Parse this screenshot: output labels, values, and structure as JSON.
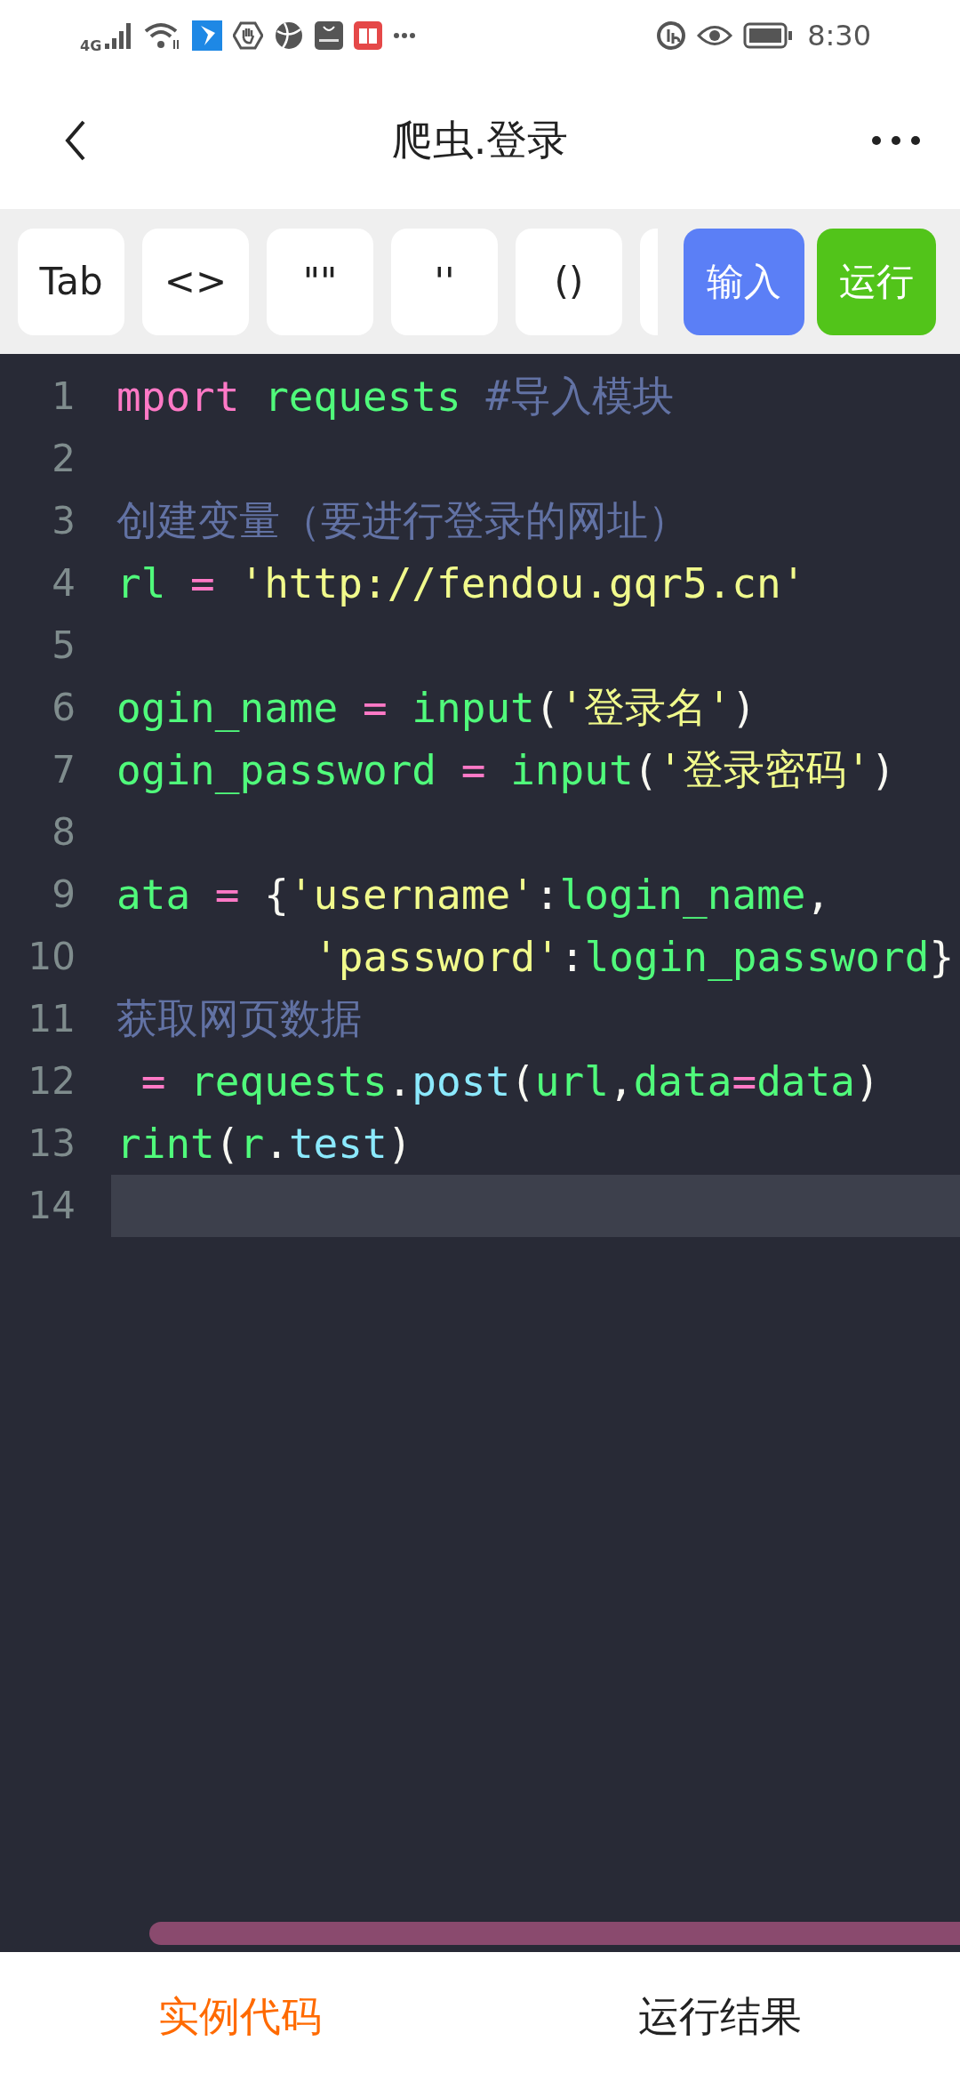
{
  "status_bar": {
    "network": "4G",
    "time": "8:30"
  },
  "header": {
    "title": "爬虫.登录"
  },
  "toolbar": {
    "keys": [
      "Tab",
      "<>",
      "\"\"",
      "''",
      "()"
    ],
    "input_button": "输入",
    "run_button": "运行"
  },
  "editor": {
    "lines": [
      {
        "number": "1",
        "current": false,
        "tokens": [
          {
            "kind": "keyword",
            "text": "mport"
          },
          {
            "kind": "name",
            "text": " requests"
          },
          {
            "kind": "comment",
            "text": " #导入模块"
          }
        ]
      },
      {
        "number": "2",
        "current": false
      },
      {
        "number": "3",
        "current": false,
        "tokens": [
          {
            "kind": "comment",
            "text": "创建变量（要进行登录的网址）"
          }
        ]
      },
      {
        "number": "4",
        "current": false,
        "tokens": [
          {
            "kind": "name",
            "text": "rl"
          },
          {
            "kind": "op",
            "text": " = "
          },
          {
            "kind": "string",
            "text": "'http://fendou.gqr5.cn'"
          }
        ]
      },
      {
        "number": "5",
        "current": false
      },
      {
        "number": "6",
        "current": false,
        "tokens": [
          {
            "kind": "name",
            "text": "ogin_name"
          },
          {
            "kind": "op",
            "text": " = "
          },
          {
            "kind": "name",
            "text": "input"
          },
          {
            "kind": "punct",
            "text": "("
          },
          {
            "kind": "string",
            "text": "'登录名'"
          },
          {
            "kind": "punct",
            "text": ")"
          }
        ]
      },
      {
        "number": "7",
        "current": false,
        "tokens": [
          {
            "kind": "name",
            "text": "ogin_password"
          },
          {
            "kind": "op",
            "text": " = "
          },
          {
            "kind": "name",
            "text": "input"
          },
          {
            "kind": "punct",
            "text": "("
          },
          {
            "kind": "string",
            "text": "'登录密码'"
          },
          {
            "kind": "punct",
            "text": ")"
          }
        ]
      },
      {
        "number": "8",
        "current": false
      },
      {
        "number": "9",
        "current": false,
        "tokens": [
          {
            "kind": "name",
            "text": "ata"
          },
          {
            "kind": "op",
            "text": " = "
          },
          {
            "kind": "punct",
            "text": "{"
          },
          {
            "kind": "string",
            "text": "'username'"
          },
          {
            "kind": "punct",
            "text": ":"
          },
          {
            "kind": "name",
            "text": "login_name"
          },
          {
            "kind": "punct",
            "text": ","
          }
        ]
      },
      {
        "number": "10",
        "current": false,
        "kind": "continuation",
        "tokens": [
          {
            "kind": "string",
            "text": "'password'"
          },
          {
            "kind": "punct",
            "text": ":"
          },
          {
            "kind": "name",
            "text": "login_password"
          },
          {
            "kind": "punct",
            "text": "}"
          }
        ]
      },
      {
        "number": "11",
        "current": false,
        "tokens": [
          {
            "kind": "comment",
            "text": "获取网页数据"
          }
        ]
      },
      {
        "number": "12",
        "current": false,
        "tokens": [
          {
            "kind": "op",
            "text": " = "
          },
          {
            "kind": "name",
            "text": "requests"
          },
          {
            "kind": "punct",
            "text": "."
          },
          {
            "kind": "method",
            "text": "post"
          },
          {
            "kind": "punct",
            "text": "("
          },
          {
            "kind": "name",
            "text": "url"
          },
          {
            "kind": "punct",
            "text": ","
          },
          {
            "kind": "name",
            "text": "data"
          },
          {
            "kind": "op",
            "text": "="
          },
          {
            "kind": "name",
            "text": "data"
          },
          {
            "kind": "punct",
            "text": ")"
          }
        ]
      },
      {
        "number": "13",
        "current": false,
        "tokens": [
          {
            "kind": "name",
            "text": "rint"
          },
          {
            "kind": "punct",
            "text": "("
          },
          {
            "kind": "name",
            "text": "r"
          },
          {
            "kind": "punct",
            "text": "."
          },
          {
            "kind": "method",
            "text": "test"
          },
          {
            "kind": "punct",
            "text": ")"
          }
        ]
      },
      {
        "number": "14",
        "current": true
      }
    ]
  },
  "bottom_tabs": [
    {
      "label": "实例代码",
      "selected": true
    },
    {
      "label": "运行结果",
      "selected": false
    }
  ]
}
